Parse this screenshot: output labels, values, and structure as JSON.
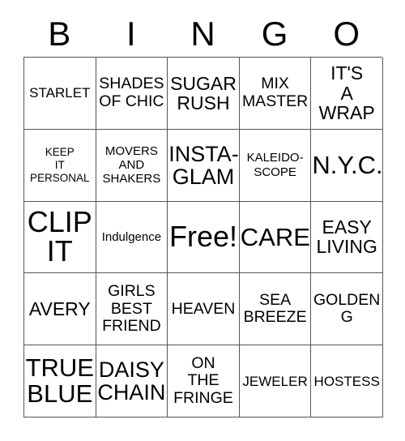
{
  "card": {
    "header_letters": [
      "B",
      "I",
      "N",
      "G",
      "O"
    ],
    "rows": [
      [
        {
          "text": "STARLET",
          "size": "s"
        },
        {
          "text": "SHADES\nOF CHIC",
          "size": "m"
        },
        {
          "text": "SUGAR\nRUSH",
          "size": "l"
        },
        {
          "text": "MIX\nMASTER",
          "size": "m"
        },
        {
          "text": "IT'S\nA\nWRAP",
          "size": "l"
        }
      ],
      [
        {
          "text": "KEEP\nIT\nPERSONAL",
          "size": "xxs"
        },
        {
          "text": "MOVERS\nAND\nSHAKERS",
          "size": "xs"
        },
        {
          "text": "INSTA-\nGLAM",
          "size": "xl"
        },
        {
          "text": "KALEIDO-\nSCOPE",
          "size": "xs"
        },
        {
          "text": "N.Y.C.",
          "size": "xxl"
        }
      ],
      [
        {
          "text": "CLIP\nIT",
          "size": "3xl"
        },
        {
          "text": "Indulgence",
          "size": "xs"
        },
        {
          "text": "Free!",
          "size": "3xl"
        },
        {
          "text": "CARE",
          "size": "xxl"
        },
        {
          "text": "EASY\nLIVING",
          "size": "l"
        }
      ],
      [
        {
          "text": "AVERY",
          "size": "l"
        },
        {
          "text": "GIRLS\nBEST\nFRIEND",
          "size": "m"
        },
        {
          "text": "HEAVEN",
          "size": "m"
        },
        {
          "text": "SEA\nBREEZE",
          "size": "m"
        },
        {
          "text": "GOLDEN\nG",
          "size": "m"
        }
      ],
      [
        {
          "text": "TRUE\nBLUE",
          "size": "xxl"
        },
        {
          "text": "DAISY\nCHAIN",
          "size": "xl"
        },
        {
          "text": "ON\nTHE\nFRINGE",
          "size": "m"
        },
        {
          "text": "JEWELER",
          "size": "s"
        },
        {
          "text": "HOSTESS",
          "size": "s"
        }
      ]
    ],
    "free_space": {
      "row": 2,
      "column": 2,
      "label": "Free!"
    },
    "colors": {
      "background": "#ffffff",
      "text": "#000000",
      "grid_line": "#555555"
    }
  }
}
